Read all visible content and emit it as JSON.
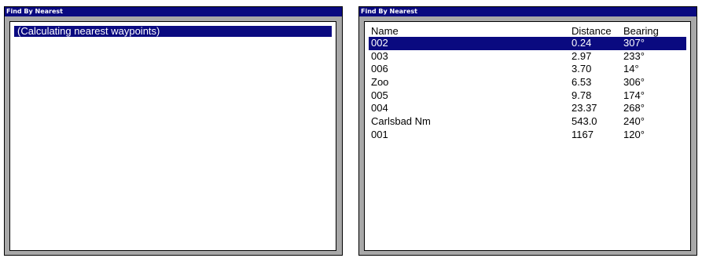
{
  "left": {
    "title": "Find By Nearest",
    "status_text": "(Calculating nearest waypoints)"
  },
  "right": {
    "title": "Find By Nearest",
    "columns": [
      "Name",
      "Distance",
      "Bearing"
    ],
    "selected_index": 0,
    "rows": [
      {
        "name": "002",
        "distance": "0.24",
        "bearing": "307°"
      },
      {
        "name": "003",
        "distance": "2.97",
        "bearing": "233°"
      },
      {
        "name": "006",
        "distance": "3.70",
        "bearing": "14°"
      },
      {
        "name": "Zoo",
        "distance": "6.53",
        "bearing": "306°"
      },
      {
        "name": "005",
        "distance": "9.78",
        "bearing": "174°"
      },
      {
        "name": "004",
        "distance": "23.37",
        "bearing": "268°"
      },
      {
        "name": "Carlsbad Nm",
        "distance": "543.0",
        "bearing": "240°"
      },
      {
        "name": "001",
        "distance": "1167",
        "bearing": "120°"
      }
    ]
  }
}
